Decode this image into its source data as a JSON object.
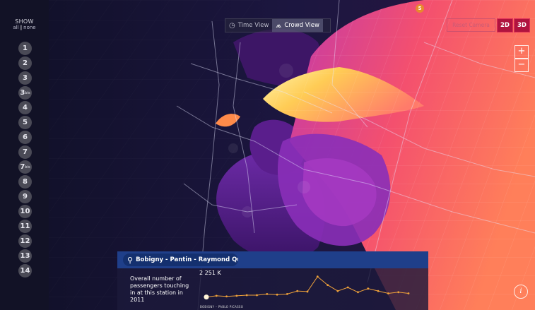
{
  "sidebar": {
    "title": "SHOW",
    "all_label": "all",
    "none_label": "none",
    "lines": [
      {
        "num": "1",
        "suffix": ""
      },
      {
        "num": "2",
        "suffix": ""
      },
      {
        "num": "3",
        "suffix": ""
      },
      {
        "num": "3",
        "suffix": "bis"
      },
      {
        "num": "4",
        "suffix": ""
      },
      {
        "num": "5",
        "suffix": ""
      },
      {
        "num": "6",
        "suffix": ""
      },
      {
        "num": "7",
        "suffix": ""
      },
      {
        "num": "7",
        "suffix": "bis"
      },
      {
        "num": "8",
        "suffix": ""
      },
      {
        "num": "9",
        "suffix": ""
      },
      {
        "num": "10",
        "suffix": ""
      },
      {
        "num": "11",
        "suffix": ""
      },
      {
        "num": "12",
        "suffix": ""
      },
      {
        "num": "13",
        "suffix": ""
      },
      {
        "num": "14",
        "suffix": ""
      }
    ]
  },
  "views": {
    "time_label": "Time View",
    "crowd_label": "Crowd View",
    "time_icon": "clock-icon",
    "crowd_icon": "crowd-icon",
    "active": "crowd"
  },
  "controls": {
    "reset_label": "Reset Camera",
    "dim_2d": "2D",
    "dim_3d": "3D",
    "zoom_in": "+",
    "zoom_out": "−",
    "info": "i"
  },
  "station": {
    "search_value": "Bobigny - Pantin - Raymond Qu...",
    "line_badge": "5",
    "peak_label": "2 251 K",
    "description": "Overall number of passengers touching in at this station in 2011",
    "sparkline_caption": "BOBIGNY – PABLO PICASSO",
    "sparkline_values": [
      2,
      3,
      2.5,
      3,
      3.5,
      3.5,
      4.5,
      4,
      4.5,
      7,
      6.5,
      19,
      12,
      7,
      10,
      6,
      9,
      7,
      5,
      6,
      5
    ],
    "sparkline_max": 20
  },
  "colors": {
    "sidebar_bg": "#12122a",
    "line_button": "#4a4a56",
    "panel_header": "#1f3f8a",
    "dim_button": "#b0133e",
    "badge_line5": "#e8892d",
    "sparkline": "#f0a23a",
    "surface_hot": "#ffe27a",
    "surface_mid": "#e8429a",
    "surface_low": "#4a1a7a"
  }
}
